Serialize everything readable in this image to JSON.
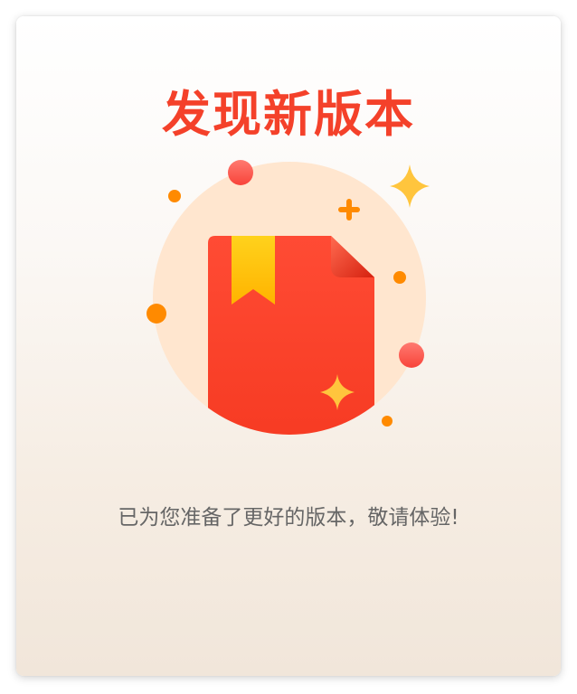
{
  "dialog": {
    "title": "发现新版本",
    "message": "已为您准备了更好的版本，敬请体验!"
  },
  "colors": {
    "title": "#f4412a",
    "message": "#666666",
    "halo": "#ffe6cf",
    "book_red": "#ff4a31",
    "book_corner": "#e32a16",
    "ribbon": "#ffc010",
    "sparkle": "#ffc53d",
    "dot_orange": "#ff8a00",
    "dot_red": "#ff5a52"
  },
  "illustration": {
    "icon": "book-update-icon"
  }
}
